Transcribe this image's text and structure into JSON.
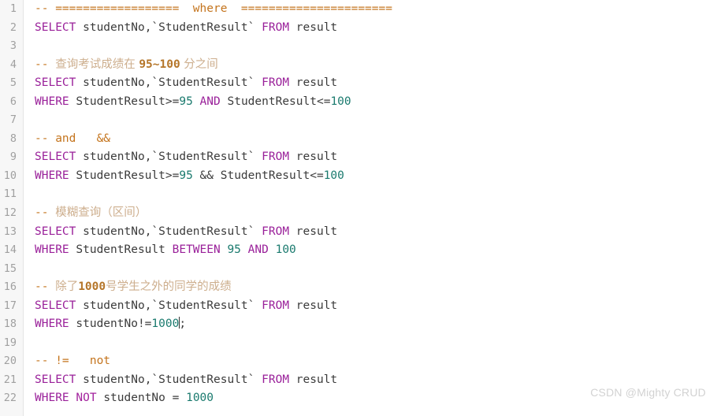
{
  "editor": {
    "language": "sql",
    "total_lines": 22,
    "background_color": "#ffffff",
    "gutter_color": "#f7f7f7",
    "colors": {
      "keyword": "#9a219a",
      "number": "#1a7a6e",
      "identifier": "#3b3b3b",
      "comment": "#c99a63",
      "comment_highlight": "#c4741d",
      "line_number": "#a0a0a0",
      "watermark": "#d2d2d2"
    }
  },
  "line_numbers": [
    "1",
    "2",
    "3",
    "4",
    "5",
    "6",
    "7",
    "8",
    "9",
    "10",
    "11",
    "12",
    "13",
    "14",
    "15",
    "16",
    "17",
    "18",
    "19",
    "20",
    "21",
    "22"
  ],
  "lines": [
    {
      "n": "1",
      "text": "-- ==================  where  ======================"
    },
    {
      "n": "2",
      "text": "SELECT studentNo,`StudentResult` FROM result"
    },
    {
      "n": "3",
      "text": ""
    },
    {
      "n": "4",
      "text": "-- 查询考试成绩在 95~100 分之间"
    },
    {
      "n": "5",
      "text": "SELECT studentNo,`StudentResult` FROM result"
    },
    {
      "n": "6",
      "text": "WHERE StudentResult>=95 AND StudentResult<=100"
    },
    {
      "n": "7",
      "text": ""
    },
    {
      "n": "8",
      "text": "-- and   &&"
    },
    {
      "n": "9",
      "text": "SELECT studentNo,`StudentResult` FROM result"
    },
    {
      "n": "10",
      "text": "WHERE StudentResult>=95 && StudentResult<=100"
    },
    {
      "n": "11",
      "text": ""
    },
    {
      "n": "12",
      "text": "-- 模糊查询（区间）"
    },
    {
      "n": "13",
      "text": "SELECT studentNo,`StudentResult` FROM result"
    },
    {
      "n": "14",
      "text": "WHERE StudentResult BETWEEN 95 AND 100"
    },
    {
      "n": "15",
      "text": ""
    },
    {
      "n": "16",
      "text": "-- 除了1000号学生之外的同学的成绩"
    },
    {
      "n": "17",
      "text": "SELECT studentNo,`StudentResult` FROM result"
    },
    {
      "n": "18",
      "text": "WHERE studentNo!=1000;"
    },
    {
      "n": "19",
      "text": ""
    },
    {
      "n": "20",
      "text": "-- !=   not"
    },
    {
      "n": "21",
      "text": "SELECT studentNo,`StudentResult` FROM result"
    },
    {
      "n": "22",
      "text": "WHERE NOT studentNo = 1000"
    }
  ],
  "tokens": {
    "l1_dashes": "-- ",
    "l1_eq_left": "==================",
    "l1_where": "  where  ",
    "l1_eq_right": "======================",
    "select": "SELECT",
    "from": "FROM",
    "where": "WHERE",
    "and": "AND",
    "not": "NOT",
    "between": "BETWEEN",
    "col_studentno": " studentNo,",
    "col_studentresult": "StudentResult",
    "tbl_result": " result",
    "backtick": "`",
    "space": " ",
    "n95": "95",
    "n100": "100",
    "n1000": "1000",
    "op_ge": "StudentResult>=",
    "op_le": " StudentResult<=",
    "amp": " && ",
    "semicolon": ";",
    "l4_dash": "-- ",
    "l4_cn1": "查询考试成绩在 ",
    "l4_range": "95~100",
    "l4_cn2": " 分之间",
    "l8_dash": "-- ",
    "l8_and": "and   &&",
    "l12_dash": "-- ",
    "l12_cn": "模糊查询（区间）",
    "l14_col": " StudentResult ",
    "l16_dash": "-- ",
    "l16_cn1": "除了",
    "l16_num": "1000",
    "l16_cn2": "号学生之外的同学的成绩",
    "l18_col": " studentNo!=",
    "l20_dash": "-- ",
    "l20_ops": "!=   not",
    "l22_col": " studentNo = "
  },
  "watermark": {
    "text": "CSDN @Mighty CRUD"
  }
}
